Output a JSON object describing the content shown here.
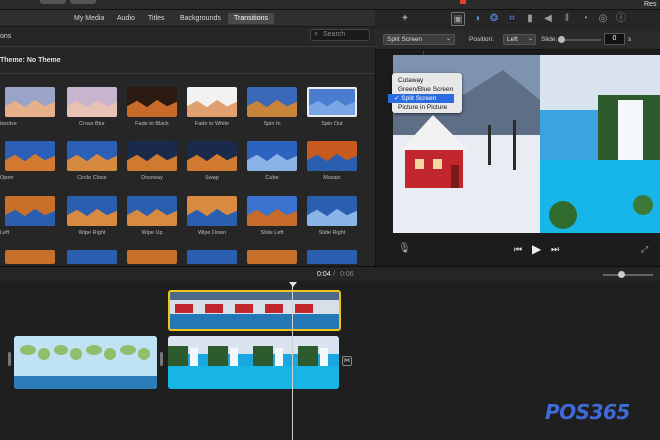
{
  "tabs": {
    "my_media": "My Media",
    "audio": "Audio",
    "titles": "Titles",
    "backgrounds": "Backgrounds",
    "transitions": "Transitions"
  },
  "sidebar_partial": "ons",
  "search_placeholder": "Search",
  "theme_label": "Theme: No Theme",
  "top_right_partial": "Res",
  "transitions": [
    {
      "label": "issolve"
    },
    {
      "label": "Cross Blur"
    },
    {
      "label": "Fade to Black"
    },
    {
      "label": "Fade to White"
    },
    {
      "label": "Spin In"
    },
    {
      "label": "Spin Out"
    },
    {
      "label": "Open"
    },
    {
      "label": "Circle Close"
    },
    {
      "label": "Doorway"
    },
    {
      "label": "Swap"
    },
    {
      "label": "Cube"
    },
    {
      "label": "Mosaic"
    },
    {
      "label": "Left"
    },
    {
      "label": "Wipe Right"
    },
    {
      "label": "Wipe Up"
    },
    {
      "label": "Wipe Down"
    },
    {
      "label": "Slide Left"
    },
    {
      "label": "Slide Right"
    }
  ],
  "overlay": {
    "mode_value": "Split Screen",
    "position_label": "Position:",
    "position_value": "Left",
    "slide_label": "Slide:",
    "slide_value": "0",
    "slide_unit": "s",
    "slide_level": 0.0,
    "menu": [
      "Cutaway",
      "Green/Blue Screen",
      "Split Screen",
      "Picture in Picture"
    ],
    "menu_selected_index": 2,
    "checkmark": "✓"
  },
  "timeline": {
    "current": "0:04",
    "separator": "/",
    "duration": "0:06"
  },
  "logo": "POS365",
  "colors": {
    "accent_blue": "#2a6be0",
    "clip_selected": "#f0c419",
    "logo_blue": "#3f6bd8",
    "arrow_red": "#e0432c"
  }
}
